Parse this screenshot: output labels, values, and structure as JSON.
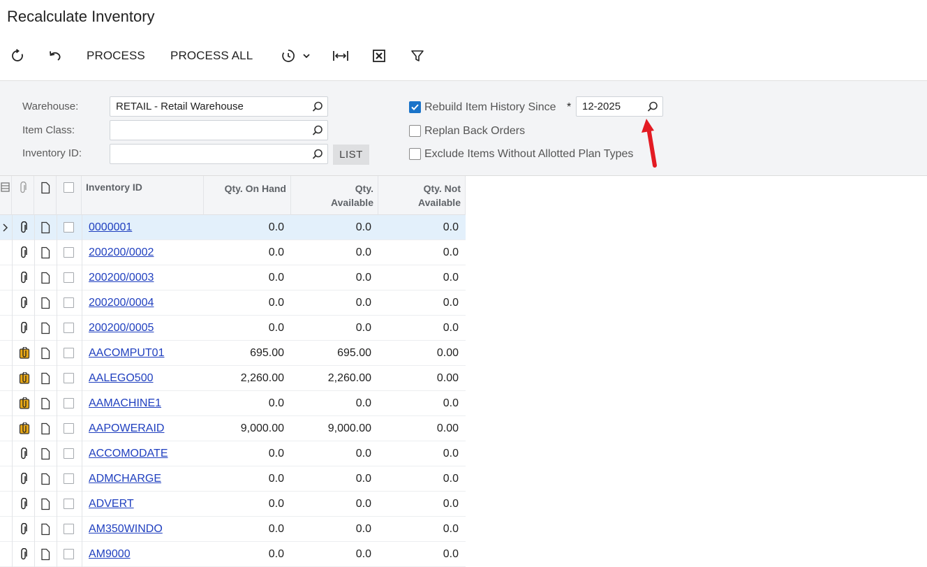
{
  "page_title": "Recalculate Inventory",
  "toolbar": {
    "refresh_icon": "refresh-icon",
    "undo_icon": "undo-icon",
    "process_label": "PROCESS",
    "process_all_label": "PROCESS ALL",
    "schedule_icon": "clock-icon",
    "fit_icon": "fit-columns-icon",
    "excel_icon": "excel-icon",
    "filter_icon": "filter-icon"
  },
  "filters": {
    "warehouse_label": "Warehouse:",
    "warehouse_value": "RETAIL - Retail Warehouse",
    "item_class_label": "Item Class:",
    "item_class_value": "",
    "inventory_id_label": "Inventory ID:",
    "inventory_id_value": "",
    "list_button": "LIST",
    "rebuild_label": "Rebuild Item History Since",
    "rebuild_checked": true,
    "required_marker": "*",
    "rebuild_period": "12-2025",
    "replan_label": "Replan Back Orders",
    "replan_checked": false,
    "exclude_label": "Exclude Items Without Allotted Plan Types",
    "exclude_checked": false
  },
  "grid": {
    "headers": {
      "inventory_id": "Inventory ID",
      "qty_on_hand": "Qty. On Hand",
      "qty_available_1": "Qty.",
      "qty_available_2": "Available",
      "qty_not_available_1": "Qty. Not",
      "qty_not_available_2": "Available"
    },
    "rows": [
      {
        "id": "0000001",
        "on_hand": "0.0",
        "available": "0.0",
        "not_available": "0.0",
        "attach": "paperclip"
      },
      {
        "id": "200200/0002",
        "on_hand": "0.0",
        "available": "0.0",
        "not_available": "0.0",
        "attach": "paperclip"
      },
      {
        "id": "200200/0003",
        "on_hand": "0.0",
        "available": "0.0",
        "not_available": "0.0",
        "attach": "paperclip"
      },
      {
        "id": "200200/0004",
        "on_hand": "0.0",
        "available": "0.0",
        "not_available": "0.0",
        "attach": "paperclip"
      },
      {
        "id": "200200/0005",
        "on_hand": "0.0",
        "available": "0.0",
        "not_available": "0.0",
        "attach": "paperclip"
      },
      {
        "id": "AACOMPUT01",
        "on_hand": "695.00",
        "available": "695.00",
        "not_available": "0.00",
        "attach": "attached"
      },
      {
        "id": "AALEGO500",
        "on_hand": "2,260.00",
        "available": "2,260.00",
        "not_available": "0.00",
        "attach": "attached"
      },
      {
        "id": "AAMACHINE1",
        "on_hand": "0.0",
        "available": "0.0",
        "not_available": "0.0",
        "attach": "attached"
      },
      {
        "id": "AAPOWERAID",
        "on_hand": "9,000.00",
        "available": "9,000.00",
        "not_available": "0.00",
        "attach": "attached"
      },
      {
        "id": "ACCOMODATE",
        "on_hand": "0.0",
        "available": "0.0",
        "not_available": "0.0",
        "attach": "paperclip"
      },
      {
        "id": "ADMCHARGE",
        "on_hand": "0.0",
        "available": "0.0",
        "not_available": "0.0",
        "attach": "paperclip"
      },
      {
        "id": "ADVERT",
        "on_hand": "0.0",
        "available": "0.0",
        "not_available": "0.0",
        "attach": "paperclip"
      },
      {
        "id": "AM350WINDO",
        "on_hand": "0.0",
        "available": "0.0",
        "not_available": "0.0",
        "attach": "paperclip"
      },
      {
        "id": "AM9000",
        "on_hand": "0.0",
        "available": "0.0",
        "not_available": "0.0",
        "attach": "paperclip"
      }
    ]
  },
  "colors": {
    "accent": "#1a73c9",
    "link": "#1f3fbf",
    "selected_row": "#e3f0fb",
    "attachment_badge": "#e8a817",
    "arrow": "#e31b23"
  }
}
